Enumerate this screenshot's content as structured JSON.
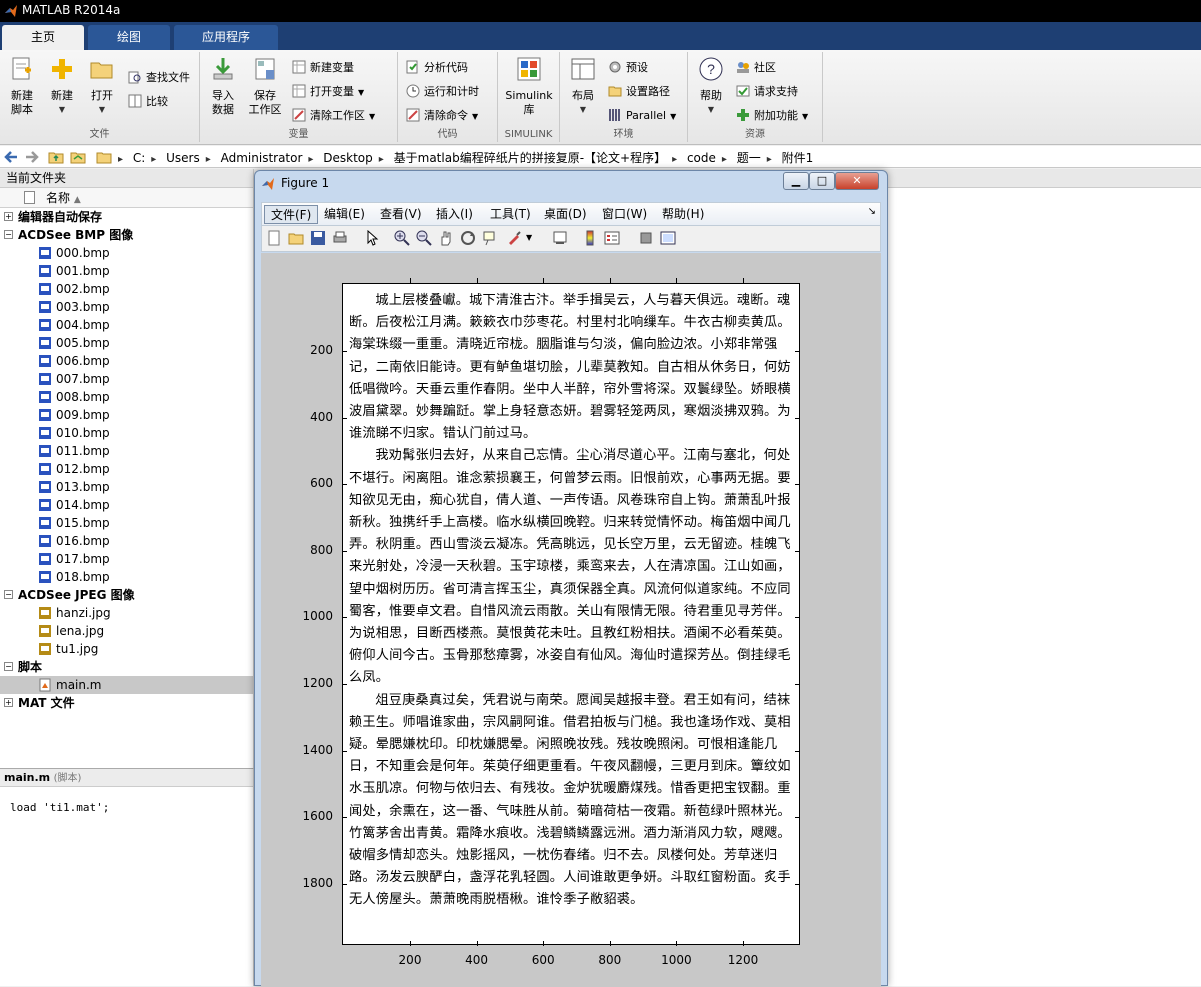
{
  "app": {
    "title": "MATLAB R2014a"
  },
  "tabs": [
    "主页",
    "绘图",
    "应用程序"
  ],
  "ribbon": {
    "file": {
      "label": "文件",
      "new_script": "新建\n脚本",
      "new": "新建",
      "open": "打开",
      "find_files": "查找文件",
      "compare": "比较"
    },
    "variable": {
      "label": "变量",
      "import": "导入\n数据",
      "save_workspace": "保存\n工作区",
      "new_variable": "新建变量",
      "open_variable": "打开变量",
      "clear_workspace": "清除工作区"
    },
    "code": {
      "label": "代码",
      "analyze": "分析代码",
      "run_time": "运行和计时",
      "clear_commands": "清除命令"
    },
    "simulink": {
      "label": "SIMULINK",
      "btn": "Simulink\n库"
    },
    "env": {
      "label": "环境",
      "layout": "布局",
      "preferences": "预设",
      "set_path": "设置路径",
      "parallel": "Parallel"
    },
    "resources": {
      "label": "资源",
      "help": "帮助",
      "community": "社区",
      "request_support": "请求支持",
      "addons": "附加功能"
    }
  },
  "path": [
    "C:",
    "Users",
    "Administrator",
    "Desktop",
    "基于matlab编程碎纸片的拼接复原-【论文+程序】",
    "code",
    "题一",
    "附件1"
  ],
  "folder_panel": {
    "title": "当前文件夹",
    "col_name": "名称",
    "groups": [
      {
        "label": "编辑器自动保存",
        "expanded": false,
        "files": []
      },
      {
        "label": "ACDSee BMP 图像",
        "expanded": true,
        "icon": "bmp-icon",
        "files": [
          "000.bmp",
          "001.bmp",
          "002.bmp",
          "003.bmp",
          "004.bmp",
          "005.bmp",
          "006.bmp",
          "007.bmp",
          "008.bmp",
          "009.bmp",
          "010.bmp",
          "011.bmp",
          "012.bmp",
          "013.bmp",
          "014.bmp",
          "015.bmp",
          "016.bmp",
          "017.bmp",
          "018.bmp"
        ]
      },
      {
        "label": "ACDSee JPEG 图像",
        "expanded": true,
        "icon": "jpg-icon",
        "files": [
          "hanzi.jpg",
          "lena.jpg",
          "tu1.jpg"
        ]
      },
      {
        "label": "脚本",
        "expanded": true,
        "icon": "m-file-icon",
        "files": [
          "main.m"
        ]
      },
      {
        "label": "MAT 文件",
        "expanded": false,
        "files": []
      }
    ],
    "selected": "main.m"
  },
  "details": {
    "title": "main.m",
    "subtitle": "(脚本)",
    "code": "load 'ti1.mat';"
  },
  "figure": {
    "title": "Figure 1",
    "menu": [
      "文件(F)",
      "编辑(E)",
      "查看(V)",
      "插入(I)",
      "工具(T)",
      "桌面(D)",
      "窗口(W)",
      "帮助(H)"
    ],
    "yticks": [
      "200",
      "400",
      "600",
      "800",
      "1000",
      "1200",
      "1400",
      "1600",
      "1800"
    ],
    "xticks": [
      "200",
      "400",
      "600",
      "800",
      "1000",
      "1200"
    ],
    "paragraphs": [
      "城上层楼叠巘。城下清淮古汴。举手揖吴云，人与暮天俱远。魂断。魂断。后夜松江月满。簌簌衣巾莎枣花。村里村北响缫车。牛衣古柳卖黄瓜。海棠珠缀一重重。清晓近帘栊。胭脂谁与匀淡，偏向脸边浓。小郑非常强记，二南依旧能诗。更有鲈鱼堪切脍，儿辈莫教知。自古相从休务日，何妨低唱微吟。天垂云重作春阴。坐中人半醉，帘外雪将深。双鬟绿坠。娇眼横波眉黛翠。妙舞蹁跹。掌上身轻意态妍。碧雾轻笼两凤，寒烟淡拂双鸦。为谁流睇不归家。错认门前过马。",
      "我劝髯张归去好，从来自己忘情。尘心消尽道心平。江南与塞北，何处不堪行。闲离阻。谁念萦损襄王，何曾梦云雨。旧恨前欢，心事两无据。要知欲见无由，痴心犹自，倩人道、一声传语。风卷珠帘自上钩。萧萧乱叶报新秋。独携纤手上高楼。临水纵横回晚鞚。归来转觉情怀动。梅笛烟中闻几弄。秋阴重。西山雪淡云凝冻。凭高眺远，见长空万里，云无留迹。桂魄飞来光射处，冷浸一天秋碧。玉宇琼楼，乘鸾来去，人在清凉国。江山如画，望中烟树历历。省可清言挥玉尘，真须保器全真。风流何似道家纯。不应同蜀客，惟要卓文君。自惜风流云雨散。关山有限情无限。待君重见寻芳伴。为说相思，目断西楼燕。莫恨黄花未吐。且教红粉相扶。酒阑不必看茱萸。俯仰人间今古。玉骨那愁瘴雾，冰姿自有仙风。海仙时遣探芳丛。倒挂绿毛么凤。",
      "俎豆庚桑真过矣，凭君说与南荣。愿闻吴越报丰登。君王如有问，结袜赖王生。师唱谁家曲，宗风嗣阿谁。借君拍板与门槌。我也逢场作戏、莫相疑。晕腮嫌枕印。印枕嫌腮晕。闲照晚妆残。残妆晚照闲。可恨相逢能几日，不知重会是何年。茱萸仔细更重看。午夜风翻幔，三更月到床。簟纹如水玉肌凉。何物与侬归去、有残妆。金炉犹暖麝煤残。惜香更把宝钗翻。重闻处，余熏在，这一番、气味胜从前。菊暗荷枯一夜霜。新苞绿叶照林光。竹篱茅舍出青黄。霜降水痕收。浅碧鳞鳞露远洲。酒力渐消风力软，飕飕。破帽多情却恋头。烛影摇风，一枕伤春绪。归不去。凤楼何处。芳草迷归路。汤发云腴酽白，盏浮花乳轻圆。人间谁敢更争妍。斗取红窗粉面。炙手无人傍屋头。萧萧晚雨脱梧楸。谁怜季子敝貂裘。"
    ]
  }
}
